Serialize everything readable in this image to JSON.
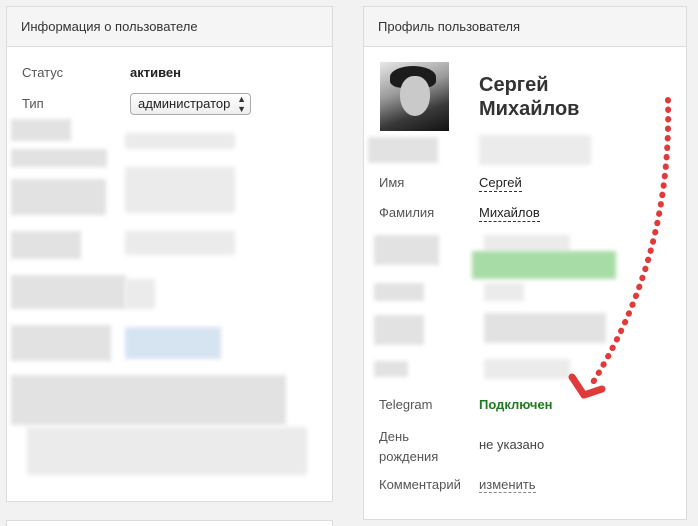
{
  "left_panel": {
    "title": "Информация о пользователе",
    "status_label": "Статус",
    "status_value": "активен",
    "type_label": "Тип",
    "type_value": "администратор"
  },
  "right_panel": {
    "title": "Профиль пользователя",
    "name_first": "Сергей",
    "name_last": "Михайлов",
    "fields": {
      "first_name_label": "Имя",
      "first_name_value": "Сергей",
      "last_name_label": "Фамилия",
      "last_name_value": "Михайлов",
      "telegram_label": "Telegram",
      "telegram_value": "Подключен",
      "birthday_label_1": "День",
      "birthday_label_2": "рождения",
      "birthday_value": "не указано",
      "comment_label": "Комментарий",
      "comment_action": "изменить"
    }
  },
  "colors": {
    "connected": "#1e7d1e",
    "arrow": "#e03a3a"
  },
  "icons": {
    "select_arrows": "up-down-caret-icon"
  }
}
